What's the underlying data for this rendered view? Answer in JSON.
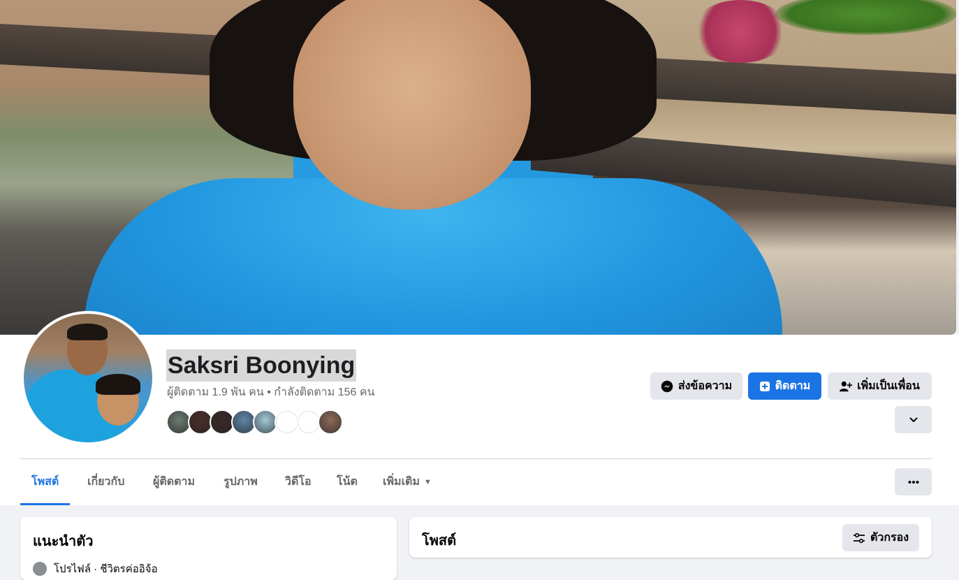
{
  "profile": {
    "name": "Saksri Boonying",
    "stats": "ผู้ติดตาม 1.9 พัน คน • กำลังติดตาม 156 คน",
    "friend_avatar_colors": [
      "#6c7b70",
      "#4a2e2a",
      "#3b2a28",
      "#5f86a8",
      "#9fc9d8",
      "#ffffff",
      "#ffffff",
      "#8c6a5a"
    ]
  },
  "actions": {
    "message_label": "ส่งข้อความ",
    "follow_label": "ติดตาม",
    "add_friend_label": "เพิ่มเป็นเพื่อน"
  },
  "tabs": [
    {
      "label": "โพสต์",
      "active": true
    },
    {
      "label": "เกี่ยวกับ",
      "active": false
    },
    {
      "label": "ผู้ติดตาม",
      "active": false
    },
    {
      "label": "รูปภาพ",
      "active": false
    },
    {
      "label": "วิดีโอ",
      "active": false
    },
    {
      "label": "โน้ต",
      "active": false
    },
    {
      "label": "เพิ่มเติม",
      "active": false
    }
  ],
  "intro": {
    "title": "แนะนำตัว",
    "first_item": "โปรไฟล์ · ชีวิตรค่ออิจ้อ"
  },
  "posts": {
    "title": "โพสต์",
    "filter_label": "ตัวกรอง"
  },
  "colors": {
    "accent": "#1b74e4",
    "page_bg": "#f0f2f5",
    "button_gray": "#e4e6eb",
    "muted_text": "#65676b"
  }
}
